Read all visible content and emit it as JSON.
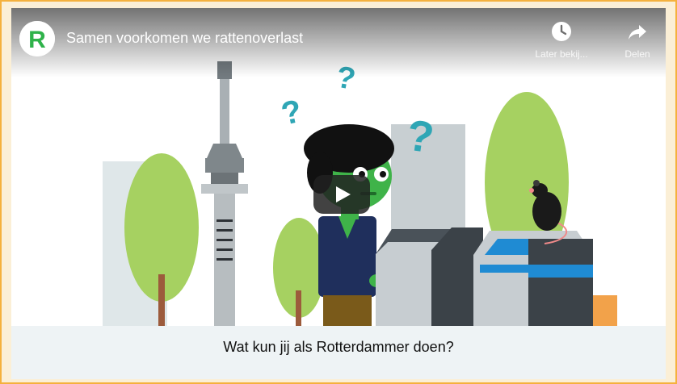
{
  "video": {
    "title": "Samen voorkomen we rattenoverlast",
    "channel_logo_letter": "R",
    "channel_logo_color": "#2fb24a"
  },
  "actions": {
    "watch_later_label": "Later bekij...",
    "share_label": "Delen"
  },
  "caption": {
    "text": "Wat kun jij als Rotterdammer doen?"
  },
  "icons": [
    "clock-icon",
    "share-arrow-icon",
    "play-icon",
    "question-mark-icon",
    "rat-icon"
  ],
  "colors": {
    "question_marks": "#2fa6b5",
    "character_skin": "#3fb349",
    "character_jacket": "#1f2f5c",
    "trees": "#a6d161",
    "container_accent": "#1f8bd3",
    "frame_border": "#f5b13d"
  }
}
